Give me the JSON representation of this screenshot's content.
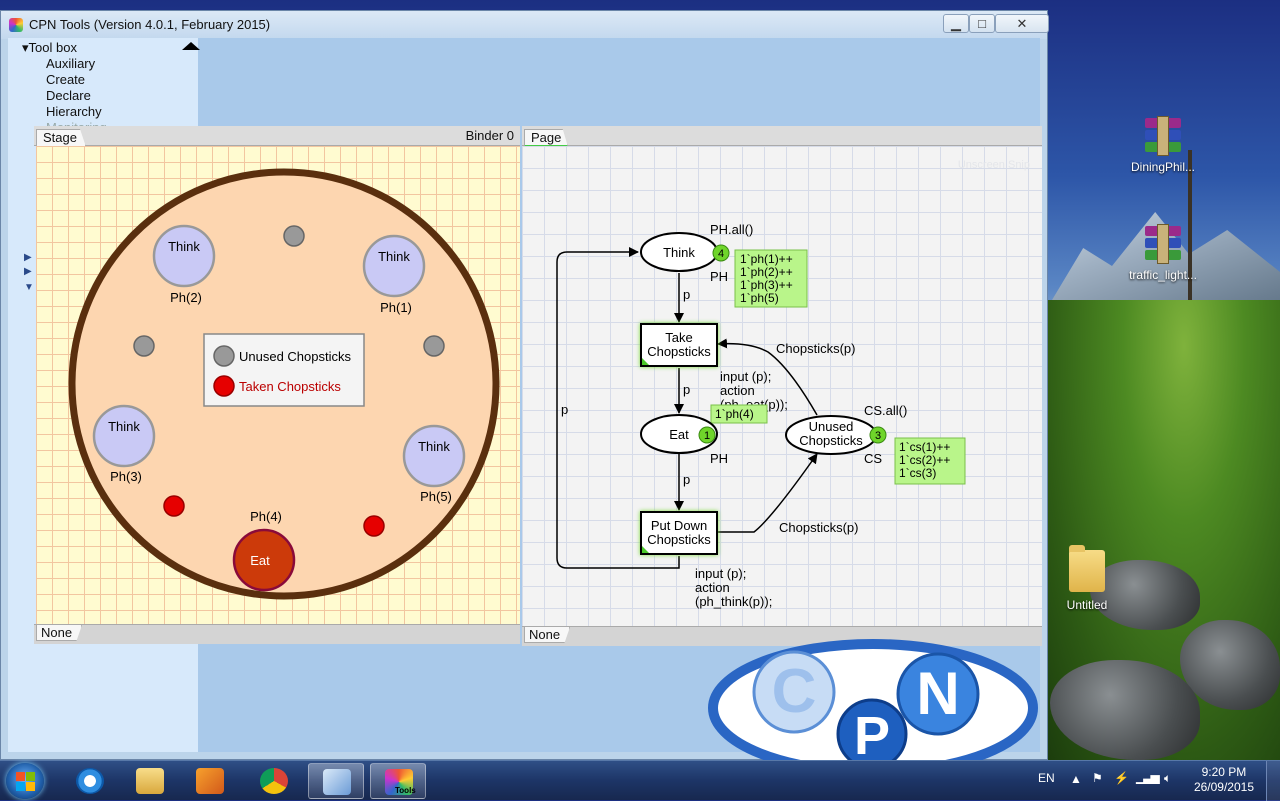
{
  "window": {
    "title": "CPN Tools (Version 4.0.1, February 2015)",
    "minimize_glyph": "▁",
    "maximize_glyph": "□",
    "close_glyph": "✕"
  },
  "toolbox": {
    "header": "Tool box",
    "items": [
      "Auxiliary",
      "Create",
      "Declare",
      "Hierarchy",
      "Monitoring"
    ]
  },
  "left_panel": {
    "tab": "Stage",
    "binder": "Binder 0",
    "status": "None"
  },
  "right_panel": {
    "tab": "Page",
    "status": "None"
  },
  "stage": {
    "philosophers": [
      {
        "state": "Think",
        "label": "Ph(2)"
      },
      {
        "state": "Think",
        "label": "Ph(1)"
      },
      {
        "state": "Think",
        "label": "Ph(3)"
      },
      {
        "state": "Think",
        "label": "Ph(5)"
      },
      {
        "state": "Eat",
        "label": "Ph(4)"
      }
    ],
    "legend": {
      "unused": "Unused Chopsticks",
      "taken": "Taken Chopsticks"
    },
    "colors": {
      "table": "#fdd6b0",
      "rim": "#5a2f0e",
      "think": "#c9c9f5",
      "eat": "#cc3a0a",
      "unused": "#999999",
      "taken": "#e60000"
    }
  },
  "net": {
    "places": {
      "think": {
        "name": "Think",
        "init": "PH.all()",
        "type": "PH",
        "count": "4",
        "marking": [
          "1`ph(1)++",
          "1`ph(2)++",
          "1`ph(3)++",
          "1`ph(5)"
        ]
      },
      "eat": {
        "name": "Eat",
        "type": "PH",
        "count": "1",
        "marking": [
          "1`ph(4)"
        ]
      },
      "unused": {
        "name_line1": "Unused",
        "name_line2": "Chopsticks",
        "init": "CS.all()",
        "type": "CS",
        "count": "3",
        "marking": [
          "1`cs(1)++",
          "1`cs(2)++",
          "1`cs(3)"
        ]
      }
    },
    "transitions": {
      "take": {
        "line1": "Take",
        "line2": "Chopsticks",
        "code": [
          "input (p);",
          "action",
          "(ph_eat(p));"
        ]
      },
      "put": {
        "line1": "Put Down",
        "line2": "Chopsticks",
        "code": [
          "input (p);",
          "action",
          "(ph_think(p));"
        ]
      }
    },
    "arcs": {
      "think_take": "p",
      "take_eat": "p",
      "eat_put": "p",
      "loop": "p",
      "unused_take": "Chopsticks(p)",
      "put_unused": "Chopsticks(p)"
    },
    "faded_text": "Unscreen Snip"
  },
  "desktop": {
    "icons": [
      "DiningPhil...",
      "traffic_light...",
      "Untitled"
    ]
  },
  "taskbar": {
    "language": "EN",
    "time": "9:20 PM",
    "date": "26/09/2015",
    "tools_label": "Tools"
  },
  "logo": {
    "letters": [
      "C",
      "P",
      "N"
    ]
  }
}
